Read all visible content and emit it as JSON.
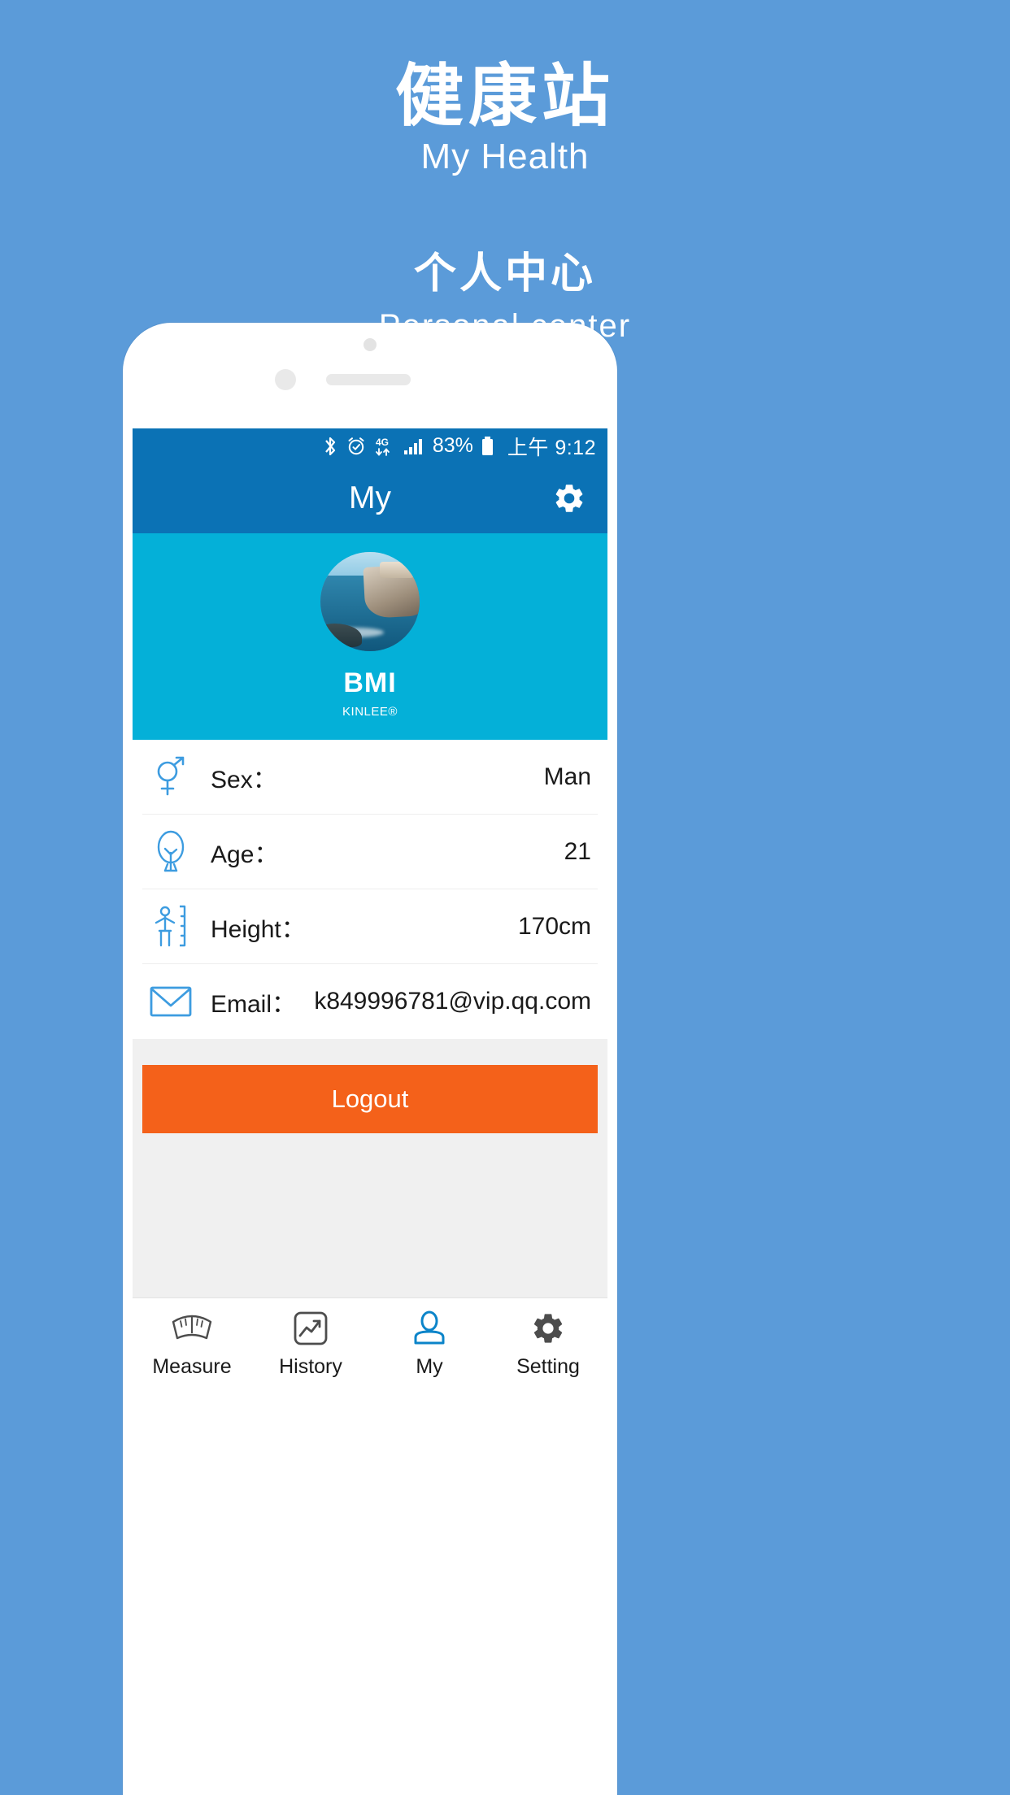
{
  "promo": {
    "title_cn": "健康站",
    "title_en": "My Health",
    "subtitle_cn": "个人中心",
    "subtitle_en": "Personal center"
  },
  "statusbar": {
    "icons": [
      "bluetooth-icon",
      "alarm-icon",
      "4g-icon",
      "signal-icon",
      "battery-icon"
    ],
    "network_label": "4G",
    "battery_percent": "83%",
    "time": "上午 9:12"
  },
  "appbar": {
    "title": "My",
    "settings_icon": "gear-icon"
  },
  "hero": {
    "avatar_icon": "avatar-photo",
    "name": "BMI",
    "brand": "KINLEE®"
  },
  "info": {
    "rows": [
      {
        "icon": "gender-icon",
        "label": "Sex：",
        "value": "Man"
      },
      {
        "icon": "age-tree-icon",
        "label": "Age：",
        "value": "21"
      },
      {
        "icon": "height-icon",
        "label": "Height：",
        "value": "170cm"
      },
      {
        "icon": "mail-icon",
        "label": "Email：",
        "value": "k849996781@vip.qq.com"
      }
    ]
  },
  "actions": {
    "logout_label": "Logout"
  },
  "tabbar": {
    "items": [
      {
        "label": "Measure",
        "icon": "scale-icon",
        "active": false
      },
      {
        "label": "History",
        "icon": "chart-icon",
        "active": false
      },
      {
        "label": "My",
        "icon": "person-icon",
        "active": true
      },
      {
        "label": "Setting",
        "icon": "gear-icon",
        "active": false
      }
    ]
  },
  "colors": {
    "page_background": "#5b9bd9",
    "appbar": "#0b72b5",
    "hero": "#04b0d8",
    "accent_icon": "#3d9ce0",
    "logout": "#f4611a",
    "tab_active": "#0b72b5"
  }
}
